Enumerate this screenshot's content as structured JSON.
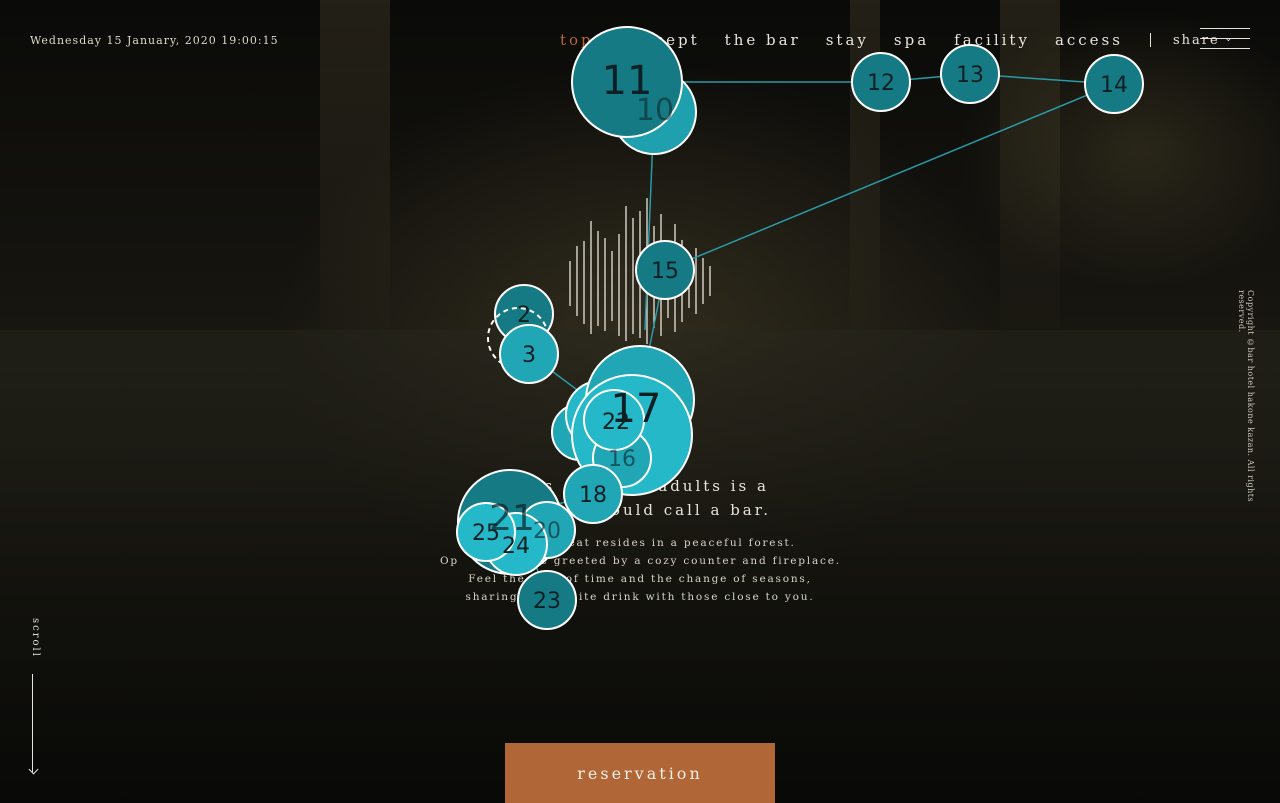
{
  "header": {
    "datetime": "Wednesday 15 January, 2020 19:00:15"
  },
  "nav": {
    "items": [
      "top",
      "concept",
      "the bar",
      "stay",
      "spa",
      "facility",
      "access"
    ],
    "active": "top",
    "share_label": "share",
    "share_icon": "chevron-down-icon",
    "menu_icon": "hamburger-icon"
  },
  "hero": {
    "title_fragment": "te|",
    "lead_line1": "This  r     for adults is a",
    "lead_line2": "      you could call a bar.",
    "body_line1": "    xury retreat resides in a peaceful forest.",
    "body_line2": "Op     do      be greeted by a cozy counter and fireplace.",
    "body_line3": "Feel the flow of time and the change of seasons,",
    "body_line4": "sharing   exquisite drink with those close to you."
  },
  "scroll": {
    "label": "scroll"
  },
  "copyright": "Copyright ©bar hotel hakone kazan. All rights reserved.",
  "cta": {
    "reservation_label": "reservation"
  },
  "overlay": {
    "node_labels": [
      "2",
      "3",
      "10",
      "11",
      "12",
      "13",
      "14",
      "15",
      "16",
      "17",
      "18",
      "20",
      "21",
      "22",
      "23",
      "24",
      "25"
    ],
    "colors": {
      "node_fill": "#1a8a94",
      "node_fill_light": "#24b8c8",
      "node_stroke": "#ffffff",
      "path": "#2a9aa8"
    }
  }
}
